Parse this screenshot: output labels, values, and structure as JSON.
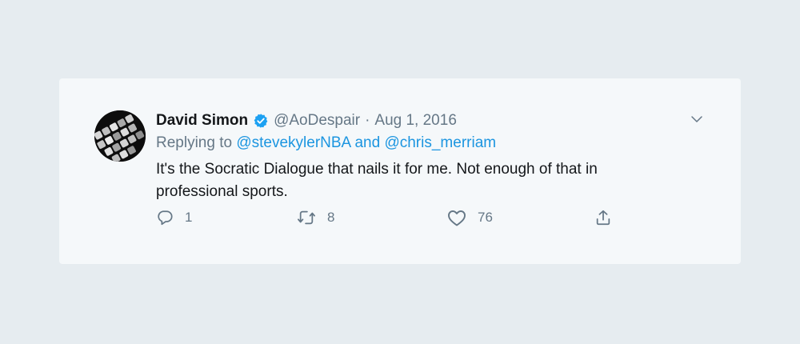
{
  "tweet": {
    "author_name": "David Simon",
    "handle": "@AoDespair",
    "separator": "·",
    "date": "Aug 1, 2016",
    "replying_prefix": "Replying to",
    "reply_to": [
      "@stevekylerNBA",
      "@chris_merriam"
    ],
    "reply_joiner": "and",
    "text": "It's the Socratic Dialogue that nails it for me. Not enough of that in professional sports.",
    "counts": {
      "replies": "1",
      "retweets": "8",
      "likes": "76"
    }
  },
  "icons": {
    "verified": "verified-badge-icon",
    "caret": "chevron-down-icon",
    "reply": "reply-bubble-icon",
    "retweet": "retweet-icon",
    "like": "heart-icon",
    "share": "share-upload-icon"
  },
  "colors": {
    "background": "#e6ecf0",
    "card": "#f5f8fa",
    "text": "#14171a",
    "secondary": "#657786",
    "link": "#1b95e0",
    "verified": "#1da1f2"
  }
}
